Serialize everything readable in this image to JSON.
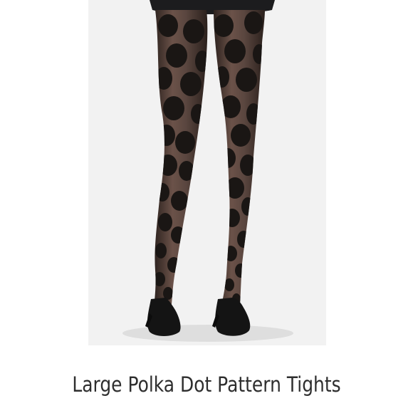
{
  "product": {
    "title": "Large Polka Dot Pattern Tights"
  },
  "photo": {
    "subject": "polka-dot-tights-photo",
    "background_color": "#f2f2f2",
    "skirt_color": "#1c1c1e",
    "hosiery_color": "#4a3a34",
    "dot_color": "#1a1614",
    "shoe_color": "#141414"
  }
}
